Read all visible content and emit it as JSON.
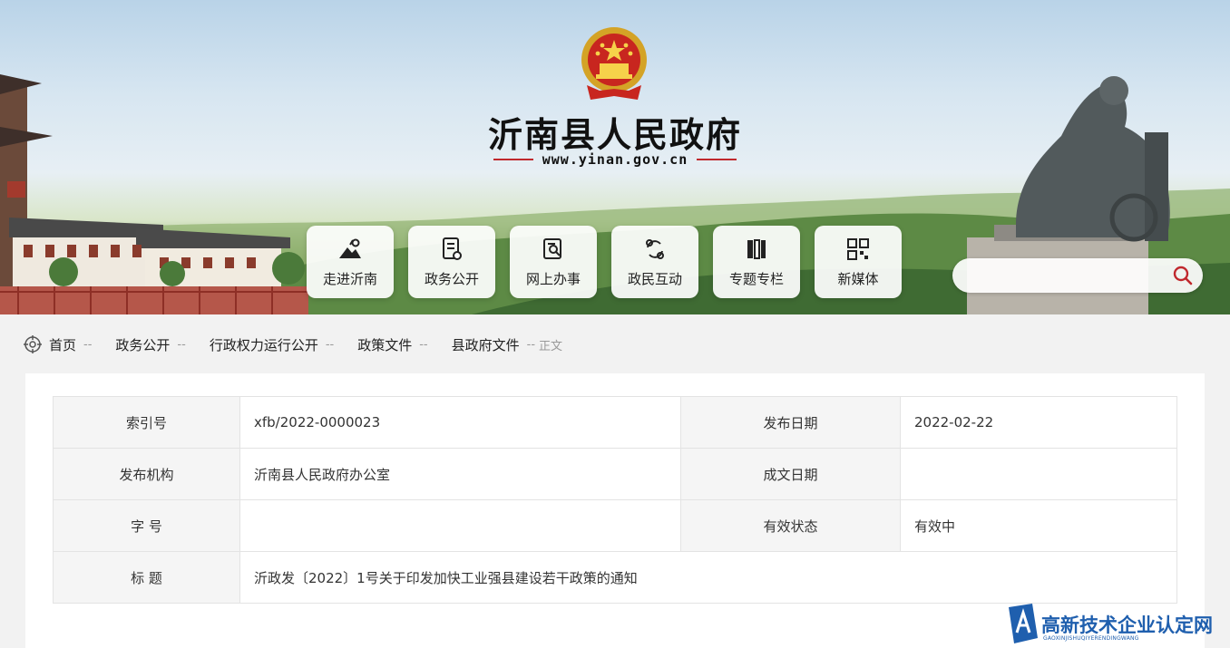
{
  "header": {
    "site_title": "沂南县人民政府",
    "site_url": "www.yinan.gov.cn",
    "emblem_icon": "national-emblem-icon"
  },
  "nav": {
    "items": [
      {
        "label": "走进沂南",
        "icon": "landscape-icon"
      },
      {
        "label": "政务公开",
        "icon": "document-icon"
      },
      {
        "label": "网上办事",
        "icon": "search-document-icon"
      },
      {
        "label": "政民互动",
        "icon": "interaction-icon"
      },
      {
        "label": "专题专栏",
        "icon": "books-icon"
      },
      {
        "label": "新媒体",
        "icon": "qrcode-icon"
      }
    ]
  },
  "search": {
    "placeholder": "",
    "value": "",
    "icon": "search-icon"
  },
  "breadcrumb": {
    "items": [
      "首页",
      "政务公开",
      "行政权力运行公开",
      "政策文件",
      "县政府文件"
    ],
    "separator": "--",
    "current": "正文"
  },
  "meta": {
    "index_label": "索引号",
    "index_value": "xfb/2022-0000023",
    "pub_date_label": "发布日期",
    "pub_date_value": "2022-02-22",
    "org_label": "发布机构",
    "org_value": "沂南县人民政府办公室",
    "made_date_label": "成文日期",
    "made_date_value": "",
    "doc_no_label": "字 号",
    "doc_no_value": "",
    "status_label": "有效状态",
    "status_value": "有效中",
    "title_label": "标 题",
    "title_value": "沂政发〔2022〕1号关于印发加快工业强县建设若干政策的通知"
  },
  "watermark": {
    "title": "高新技术企业认定网",
    "subtitle": "GAOXINJISHUQIYERENDINGWANG"
  },
  "colors": {
    "accent_red": "#c0282d",
    "watermark_blue": "#1f5fae",
    "page_bg": "#f2f2f2"
  }
}
